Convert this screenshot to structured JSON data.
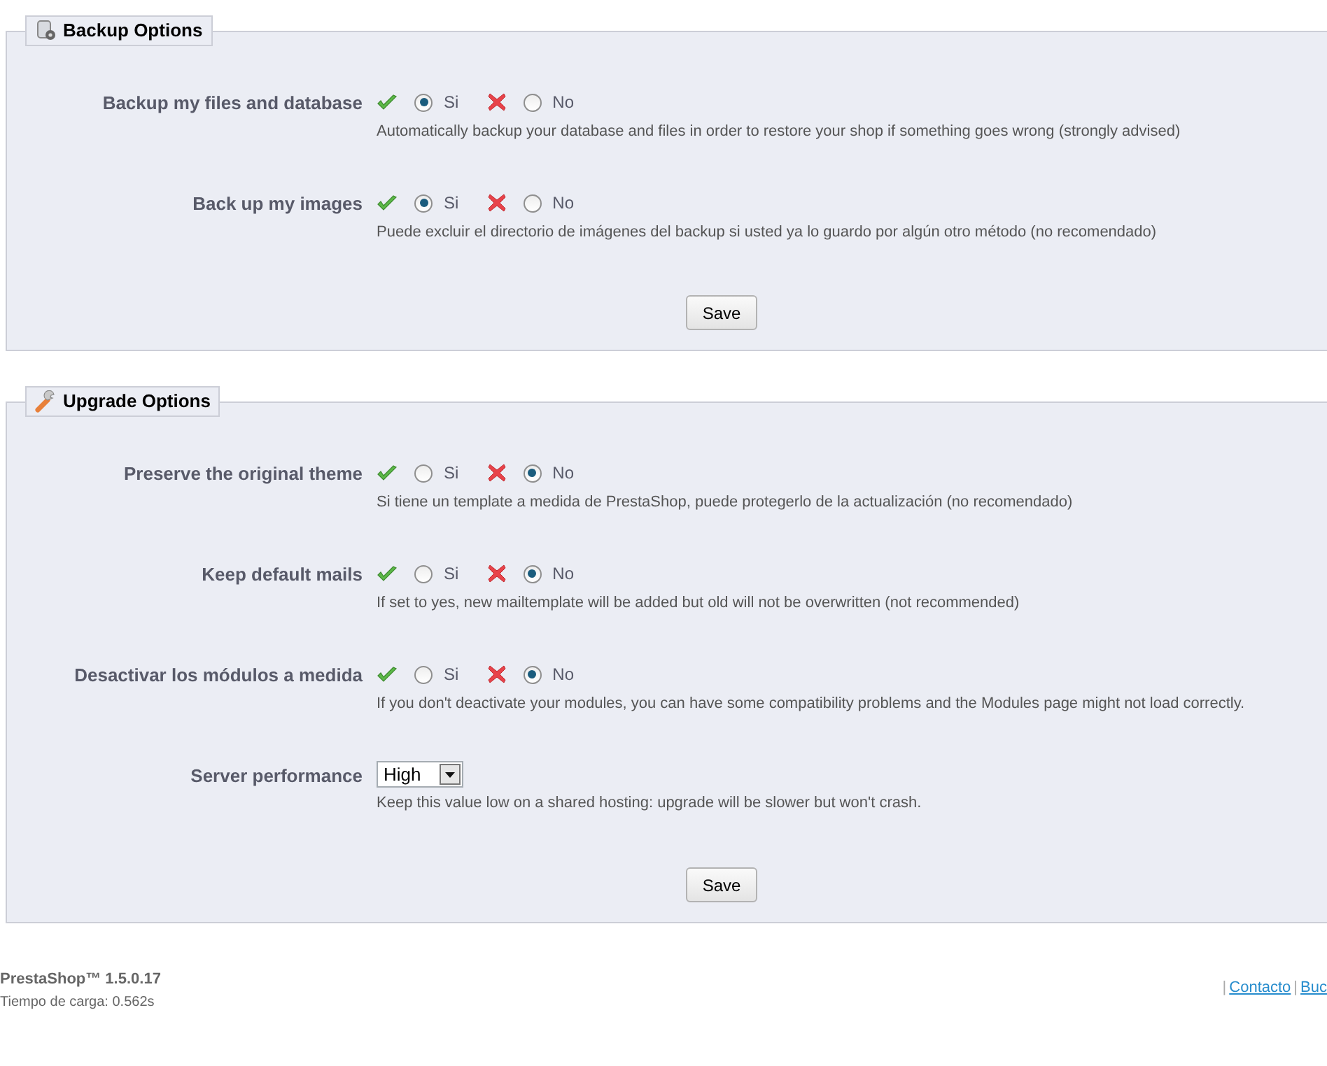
{
  "sections": [
    {
      "title": "Backup Options",
      "kind": "backup",
      "fields": [
        {
          "kind": "radio",
          "label": "Backup my files and database",
          "options": [
            {
              "label": "Si",
              "selected": true
            },
            {
              "label": "No",
              "selected": false
            }
          ],
          "description": "Automatically backup your database and files in order to restore your shop if something goes wrong (strongly advised)"
        },
        {
          "kind": "radio",
          "label": "Back up my images",
          "options": [
            {
              "label": "Si",
              "selected": true
            },
            {
              "label": "No",
              "selected": false
            }
          ],
          "description": "Puede excluir el directorio de imágenes del backup si usted ya lo guardo por algún otro método (no recomendado)"
        }
      ],
      "button": "Save"
    },
    {
      "title": "Upgrade Options",
      "kind": "upgrade",
      "fields": [
        {
          "kind": "radio",
          "label": "Preserve the original theme",
          "options": [
            {
              "label": "Si",
              "selected": false
            },
            {
              "label": "No",
              "selected": true
            }
          ],
          "description": "Si tiene un template a medida de PrestaShop, puede protegerlo de la actualización (no recomendado)"
        },
        {
          "kind": "radio",
          "label": "Keep default mails",
          "options": [
            {
              "label": "Si",
              "selected": false
            },
            {
              "label": "No",
              "selected": true
            }
          ],
          "description": "If set to yes, new mailtemplate will be added but old will not be overwritten (not recommended)"
        },
        {
          "kind": "radio",
          "label": "Desactivar los módulos a medida",
          "options": [
            {
              "label": "Si",
              "selected": false
            },
            {
              "label": "No",
              "selected": true
            }
          ],
          "description": "If you don't deactivate your modules, you can have some compatibility problems and the Modules page might not load correctly."
        },
        {
          "kind": "select",
          "label": "Server performance",
          "value": "High",
          "description": "Keep this value low on a shared hosting: upgrade will be slower but won't crash."
        }
      ],
      "button": "Save"
    }
  ],
  "footer": {
    "version": "PrestaShop™ 1.5.0.17",
    "load_time": "Tiempo de carga: 0.562s",
    "right": [
      {
        "kind": "separator",
        "text": "|"
      },
      {
        "kind": "link",
        "text": "Contacto"
      },
      {
        "kind": "separator",
        "text": "|"
      },
      {
        "kind": "link",
        "text": "Buc"
      }
    ]
  }
}
